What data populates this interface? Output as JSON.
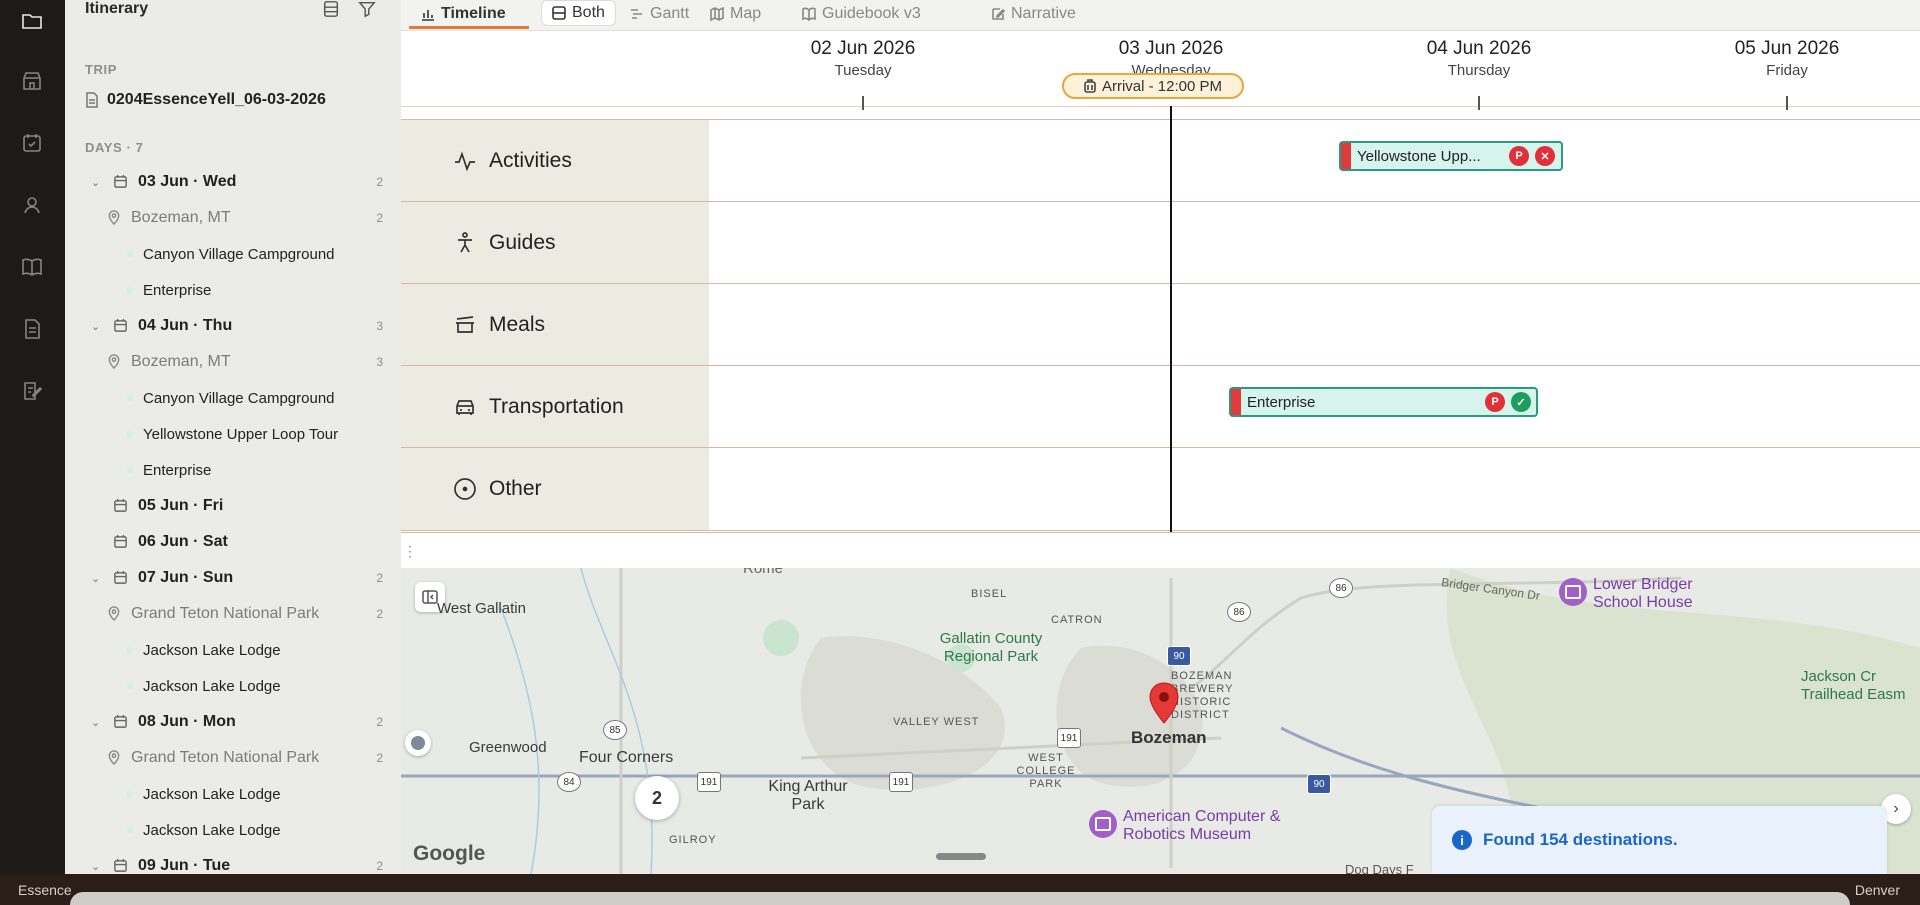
{
  "sidebar": {
    "title": "Itinerary",
    "trip_section": "TRIP",
    "trip_name": "0204EssenceYell_06-03-2026",
    "days_section": "DAYS · 7",
    "rows": [
      {
        "kind": "day",
        "label": "03 Jun · Wed",
        "count": "2",
        "expanded": true
      },
      {
        "kind": "loc",
        "label": "Bozeman, MT",
        "count": "2"
      },
      {
        "kind": "item",
        "label": "Canyon Village Campground"
      },
      {
        "kind": "item",
        "label": "Enterprise"
      },
      {
        "kind": "day",
        "label": "04 Jun · Thu",
        "count": "3",
        "expanded": true
      },
      {
        "kind": "loc",
        "label": "Bozeman, MT",
        "count": "3"
      },
      {
        "kind": "item",
        "label": "Canyon Village Campground"
      },
      {
        "kind": "item",
        "label": "Yellowstone Upper Loop Tour"
      },
      {
        "kind": "item",
        "label": "Enterprise"
      },
      {
        "kind": "day",
        "label": "05 Jun · Fri",
        "count": "",
        "expanded": false
      },
      {
        "kind": "day",
        "label": "06 Jun · Sat",
        "count": "",
        "expanded": false
      },
      {
        "kind": "day",
        "label": "07 Jun · Sun",
        "count": "2",
        "expanded": true
      },
      {
        "kind": "loc",
        "label": "Grand Teton National Park",
        "count": "2"
      },
      {
        "kind": "item",
        "label": "Jackson Lake Lodge"
      },
      {
        "kind": "item",
        "label": "Jackson Lake Lodge"
      },
      {
        "kind": "day",
        "label": "08 Jun · Mon",
        "count": "2",
        "expanded": true
      },
      {
        "kind": "loc",
        "label": "Grand Teton National Park",
        "count": "2"
      },
      {
        "kind": "item",
        "label": "Jackson Lake Lodge"
      },
      {
        "kind": "item",
        "label": "Jackson Lake Lodge"
      },
      {
        "kind": "day",
        "label": "09 Jun · Tue",
        "count": "2",
        "expanded": true
      }
    ]
  },
  "tabs": {
    "timeline": "Timeline",
    "both": "Both",
    "gantt": "Gantt",
    "map": "Map",
    "guidebook": "Guidebook v3",
    "narrative": "Narrative"
  },
  "timeline": {
    "dates": [
      {
        "date": "02 Jun 2026",
        "weekday": "Tuesday"
      },
      {
        "date": "03 Jun 2026",
        "weekday": "Wednesday"
      },
      {
        "date": "04 Jun 2026",
        "weekday": "Thursday"
      },
      {
        "date": "05 Jun 2026",
        "weekday": "Friday"
      }
    ],
    "arrival": "Arrival - 12:00 PM",
    "lanes": [
      "Activities",
      "Guides",
      "Meals",
      "Transportation",
      "Other"
    ],
    "events": [
      {
        "lane": "Activities",
        "label": "Yellowstone Upp...",
        "badges": [
          "P",
          "x"
        ]
      },
      {
        "lane": "Transportation",
        "label": "Enterprise",
        "badges": [
          "P",
          "ok"
        ]
      }
    ]
  },
  "map": {
    "labels": {
      "west_gallatin": "West Gallatin",
      "bisel": "BISEL",
      "catron": "CATRON",
      "gallatin_park": "Gallatin County Regional Park",
      "bridger_canyon": "Bridger Canyon Dr",
      "lower_bridger": "Lower Bridger School House",
      "jackson_creek": "Jackson Cr Trailhead Easm",
      "brewery": "BOZEMAN BREWERY HISTORIC DISTRICT",
      "valley_west": "VALLEY WEST",
      "greenwood": "Greenwood",
      "four_corners": "Four Corners",
      "bozeman": "Bozeman",
      "west_college_park": "WEST COLLEGE PARK",
      "king_arthur": "King Arthur Park",
      "museum": "American Computer & Robotics Museum",
      "gilroy": "GILROY",
      "dog_days": "Dog Days F",
      "rome": "Rome"
    },
    "shields": {
      "i90a": "90",
      "i90b": "90",
      "r86a": "86",
      "r86b": "86",
      "r191a": "191",
      "r191b": "191",
      "r191c": "191",
      "r85": "85",
      "r84": "84"
    },
    "cluster_count": "2",
    "google": "Google",
    "toast": "Found 154 destinations."
  },
  "status": {
    "left": "Essence",
    "right": "Denver"
  },
  "colors": {
    "accent": "#e07a3a",
    "event_fill": "#d6f4ec",
    "event_border": "#2a9a80",
    "now_line": "#111111"
  }
}
